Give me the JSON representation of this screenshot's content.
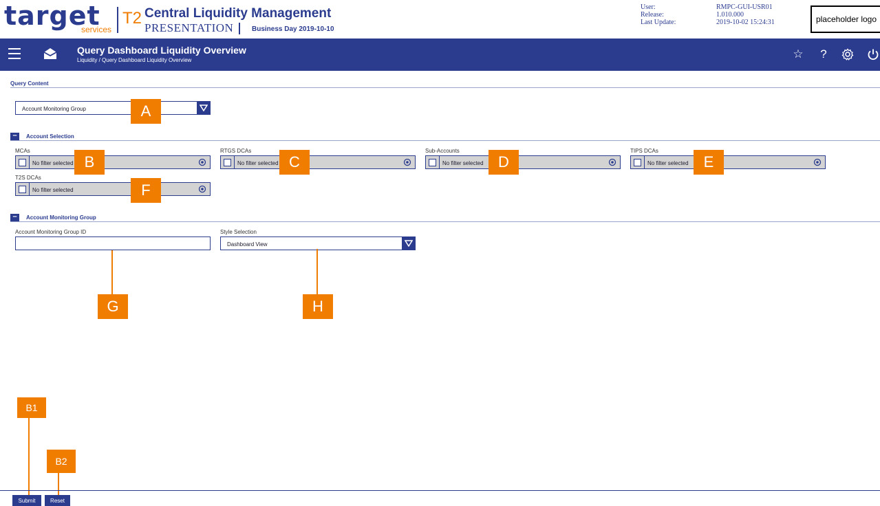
{
  "header": {
    "logo_text": "target",
    "logo_sub": "services",
    "product": "T2",
    "app_title": "Central Liquidity Management",
    "environment": "PRESENTATION",
    "business_day": "Business Day 2019-10-10",
    "meta_labels": [
      "User:",
      "Release:",
      "Last Update:"
    ],
    "meta_values": [
      "RMPC-GUI-USR01",
      "1.010.000",
      "2019-10-02 15:24:31"
    ],
    "placeholder_logo": "placeholder logo"
  },
  "nav": {
    "title": "Query Dashboard Liquidity Overview",
    "breadcrumb": "Liquidity  /  Query Dashboard Liquidity Overview",
    "icons": [
      "star-icon",
      "help-icon",
      "settings-icon",
      "power-icon"
    ]
  },
  "query_content": {
    "title": "Query Content",
    "selected": "Account Monitoring Group"
  },
  "account_selection": {
    "title": "Account Selection",
    "fields": [
      {
        "label": "MCAs",
        "value": "No filter selected"
      },
      {
        "label": "RTGS DCAs",
        "value": "No filter selected"
      },
      {
        "label": "Sub-Accounts",
        "value": "No filter selected"
      },
      {
        "label": "TIPS DCAs",
        "value": "No filter selected"
      },
      {
        "label": "T2S DCAs",
        "value": "No filter selected"
      }
    ]
  },
  "account_monitoring_group": {
    "title": "Account Monitoring Group",
    "id_label": "Account Monitoring Group ID",
    "id_value": "",
    "style_label": "Style Selection",
    "style_value": "Dashboard View"
  },
  "callouts": [
    "A",
    "B",
    "C",
    "D",
    "E",
    "F",
    "G",
    "H",
    "B1",
    "B2"
  ],
  "footer": {
    "submit": "Submit",
    "reset": "Reset"
  },
  "colors": {
    "primary": "#2b3c8f",
    "accent": "#f07d00",
    "field_bg": "#d3d3d3"
  }
}
